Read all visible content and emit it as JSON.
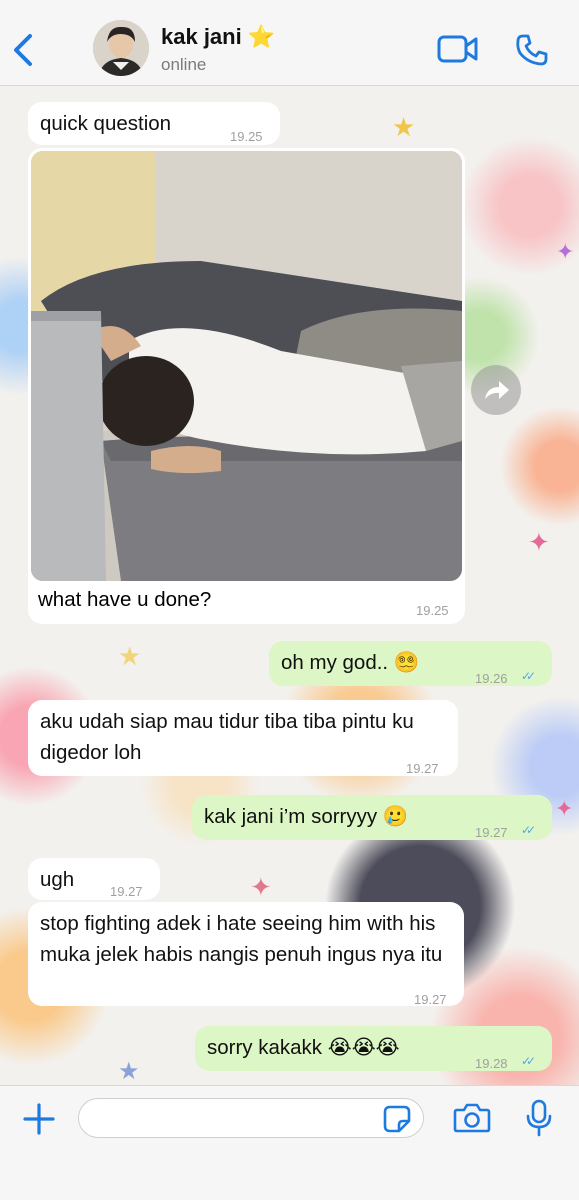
{
  "header": {
    "contact_name": "kak jani ⭐",
    "status": "online",
    "icons": [
      "back-chevron-icon",
      "avatar",
      "video-camera-icon",
      "phone-icon"
    ]
  },
  "messages": [
    {
      "direction": "in",
      "text": "quick question",
      "time": "19.25"
    },
    {
      "direction": "in",
      "type": "photo",
      "caption": "what have u done?",
      "time": "19.25"
    },
    {
      "direction": "out",
      "text": "oh my god.. 😵‍💫",
      "time": "19.26",
      "read": true
    },
    {
      "direction": "in",
      "text": "aku udah siap mau tidur tiba tiba pintu ku digedor loh",
      "time": "19.27"
    },
    {
      "direction": "out",
      "text": "kak jani i’m sorryyy 🥲",
      "time": "19.27",
      "read": true
    },
    {
      "direction": "in",
      "text": "ugh",
      "time": "19.27"
    },
    {
      "direction": "in",
      "text": "stop fighting adek i hate seeing him with his muka jelek habis nangis penuh ingus nya itu",
      "time": "19.27"
    },
    {
      "direction": "out",
      "text": "sorry kakakk 😭😭😭",
      "time": "19.28",
      "read": true
    }
  ],
  "input": {
    "placeholder": "",
    "value": ""
  },
  "colors": {
    "accent": "#1f7ae0",
    "outgoing_bubble": "#dcf7c5",
    "incoming_bubble": "#ffffff",
    "read_ticks": "#5aa6e6"
  }
}
